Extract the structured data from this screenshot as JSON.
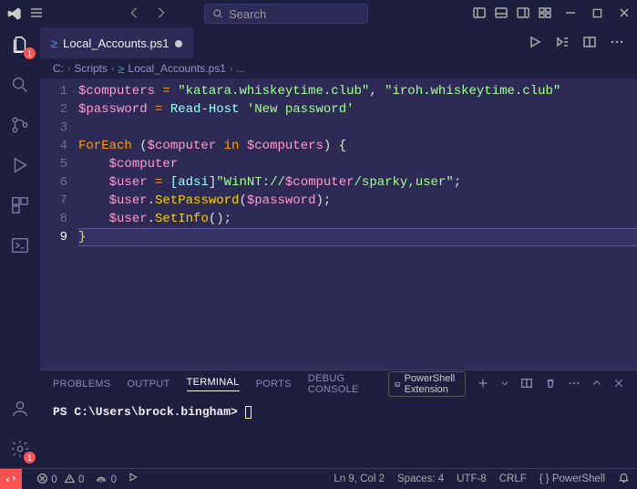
{
  "title_bar": {
    "search_placeholder": "Search"
  },
  "activity_bar": {
    "explorer_badge": "1",
    "settings_badge": "1"
  },
  "tab": {
    "filename": "Local_Accounts.ps1"
  },
  "breadcrumbs": {
    "seg0": "C:",
    "seg1": "Scripts",
    "seg2": "Local_Accounts.ps1",
    "seg3": "..."
  },
  "editor": {
    "line_numbers": [
      "1",
      "2",
      "3",
      "4",
      "5",
      "6",
      "7",
      "8",
      "9"
    ],
    "current_line_index": 8,
    "code": {
      "l1_var1": "$computers",
      "l1_eq": " = ",
      "l1_str1": "\"katara.whiskeytime.club\"",
      "l1_comma": ", ",
      "l1_str2": "\"iroh.whiskeytime.club\"",
      "l2_var": "$password",
      "l2_eq": " = ",
      "l2_cmd": "Read-Host",
      "l2_sp": " ",
      "l2_str": "'New password'",
      "l4_kw": "ForEach",
      "l4_sp1": " (",
      "l4_var1": "$computer",
      "l4_in": " in ",
      "l4_var2": "$computers",
      "l4_close": ") ",
      "l4_brace": "{",
      "l5_indent": "    ",
      "l5_var": "$computer",
      "l6_indent": "    ",
      "l6_var": "$user",
      "l6_eq": " = ",
      "l6_type": "[adsi]",
      "l6_strA": "\"WinNT://",
      "l6_strVar": "$computer",
      "l6_strB": "/sparky,user\"",
      "l6_semi": ";",
      "l7_indent": "    ",
      "l7_var": "$user",
      "l7_dot": ".",
      "l7_method": "SetPassword",
      "l7_open": "(",
      "l7_arg": "$password",
      "l7_close": ");",
      "l8_indent": "    ",
      "l8_var": "$user",
      "l8_dot": ".",
      "l8_method": "SetInfo",
      "l8_parens": "();",
      "l9_brace": "}"
    }
  },
  "panel": {
    "tabs": {
      "problems": "PROBLEMS",
      "output": "OUTPUT",
      "terminal": "TERMINAL",
      "ports": "PORTS",
      "debug": "DEBUG CONSOLE"
    },
    "shell_label": "PowerShell Extension",
    "prompt_prefix": "PS ",
    "prompt_path": "C:\\Users\\brock.bingham",
    "prompt_suffix": ">"
  },
  "status": {
    "errors": "0",
    "warnings": "0",
    "ports": "0",
    "line_col": "Ln 9, Col 2",
    "spaces": "Spaces: 4",
    "encoding": "UTF-8",
    "eol": "CRLF",
    "language": "PowerShell"
  }
}
